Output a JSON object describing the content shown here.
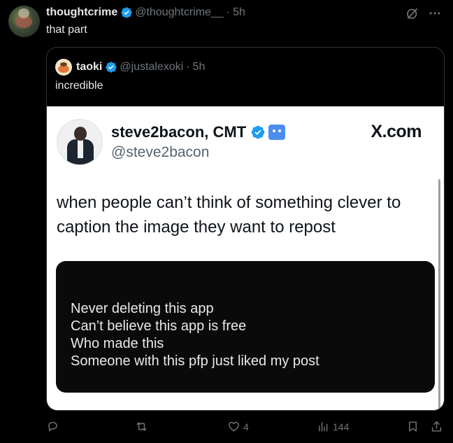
{
  "post": {
    "display_name": "thoughtcrime",
    "handle": "@thoughtcrime__",
    "separator": "·",
    "time": "5h",
    "text": "that part"
  },
  "quoted": {
    "display_name": "taoki",
    "handle": "@justalexoki",
    "separator": "·",
    "time": "5h",
    "text": "incredible"
  },
  "card": {
    "display_name": "steve2bacon, CMT",
    "handle": "@steve2bacon",
    "brand": "X.com",
    "caption": "when people can’t think of something clever to caption the image they want to repost",
    "inner_lines": [
      "Never deleting this app",
      "Can’t believe this app is free",
      "Who made this",
      "Someone with this pfp just liked my post"
    ]
  },
  "actions": {
    "reply_count": "",
    "repost_count": "",
    "like_count": "4",
    "views_count": "144"
  },
  "colors": {
    "background": "#000000",
    "text": "#e7e9ea",
    "muted": "#71767b",
    "verified": "#1d9bf0",
    "card_bg": "#ffffff"
  }
}
